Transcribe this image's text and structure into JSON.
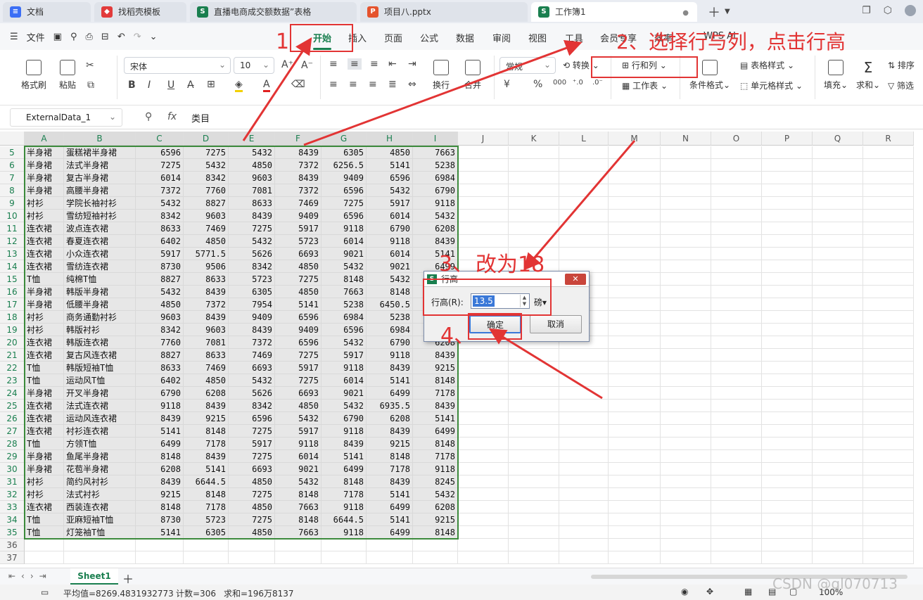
{
  "tabs": [
    {
      "label": "文档",
      "icon": "doc-icon",
      "color": "#3b6ef5"
    },
    {
      "label": "找稻壳模板",
      "icon": "docer-icon",
      "color": "#e23b3b"
    },
    {
      "label": "直播电商成交额数据”表格",
      "icon": "sheet-icon",
      "color": "#1a7f4f"
    },
    {
      "label": "项目八.pptx",
      "icon": "ppt-icon",
      "color": "#e5532d"
    },
    {
      "label": "工作簿1",
      "icon": "sheet-icon",
      "color": "#1a7f4f"
    }
  ],
  "menubar": {
    "file_label": "文件",
    "items": [
      "开始",
      "插入",
      "页面",
      "公式",
      "数据",
      "审阅",
      "视图",
      "工具",
      "会员专享",
      "效率",
      "WPS AI"
    ]
  },
  "ribbon": {
    "format_painter": "格式刷",
    "paste": "粘贴",
    "font_name": "宋体",
    "font_size": "10",
    "wrap": "换行",
    "merge": "合并",
    "number_format": "常规",
    "convert": "转换",
    "row_col": "行和列",
    "worksheet": "工作表",
    "table_style": "表格样式",
    "cond_format": "条件格式",
    "cell_style": "单元格样式",
    "fill": "填充",
    "sum": "求和",
    "sort": "排序",
    "filter": "筛选"
  },
  "formula_bar": {
    "name_box": "ExternalData_1",
    "content": "类目"
  },
  "columns": [
    "A",
    "B",
    "C",
    "D",
    "E",
    "F",
    "G",
    "H",
    "I",
    "J",
    "K",
    "L",
    "M",
    "N",
    "O",
    "P",
    "Q",
    "R"
  ],
  "rows": [
    {
      "n": "5",
      "a": "半身裙",
      "b": "蛋糕裙半身裙",
      "v": [
        "6596",
        "7275",
        "5432",
        "8439",
        "6305",
        "4850",
        "7663"
      ]
    },
    {
      "n": "6",
      "a": "半身裙",
      "b": "法式半身裙",
      "v": [
        "7275",
        "5432",
        "4850",
        "7372",
        "6256.5",
        "5141",
        "5238"
      ]
    },
    {
      "n": "7",
      "a": "半身裙",
      "b": "复古半身裙",
      "v": [
        "6014",
        "8342",
        "9603",
        "8439",
        "9409",
        "6596",
        "6984"
      ]
    },
    {
      "n": "8",
      "a": "半身裙",
      "b": "高腰半身裙",
      "v": [
        "7372",
        "7760",
        "7081",
        "7372",
        "6596",
        "5432",
        "6790"
      ]
    },
    {
      "n": "9",
      "a": "衬衫",
      "b": "学院长袖衬衫",
      "v": [
        "5432",
        "8827",
        "8633",
        "7469",
        "7275",
        "5917",
        "9118"
      ]
    },
    {
      "n": "10",
      "a": "衬衫",
      "b": "雪纺短袖衬衫",
      "v": [
        "8342",
        "9603",
        "8439",
        "9409",
        "6596",
        "6014",
        "5432"
      ]
    },
    {
      "n": "11",
      "a": "连衣裙",
      "b": "波点连衣裙",
      "v": [
        "8633",
        "7469",
        "7275",
        "5917",
        "9118",
        "6790",
        "6208"
      ]
    },
    {
      "n": "12",
      "a": "连衣裙",
      "b": "春夏连衣裙",
      "v": [
        "6402",
        "4850",
        "5432",
        "5723",
        "6014",
        "9118",
        "8439"
      ]
    },
    {
      "n": "13",
      "a": "连衣裙",
      "b": "小众连衣裙",
      "v": [
        "5917",
        "5771.5",
        "5626",
        "6693",
        "9021",
        "6014",
        "5141"
      ]
    },
    {
      "n": "14",
      "a": "连衣裙",
      "b": "雪纺连衣裙",
      "v": [
        "8730",
        "9506",
        "8342",
        "4850",
        "5432",
        "9021",
        "6499"
      ]
    },
    {
      "n": "15",
      "a": "T恤",
      "b": "纯棉T恤",
      "v": [
        "8827",
        "8633",
        "5723",
        "7275",
        "8148",
        "5432",
        "7178"
      ]
    },
    {
      "n": "16",
      "a": "半身裙",
      "b": "韩版半身裙",
      "v": [
        "5432",
        "8439",
        "6305",
        "4850",
        "7663",
        "8148",
        "6499"
      ]
    },
    {
      "n": "17",
      "a": "半身裙",
      "b": "低腰半身裙",
      "v": [
        "4850",
        "7372",
        "7954",
        "5141",
        "5238",
        "6450.5",
        "9118"
      ]
    },
    {
      "n": "18",
      "a": "衬衫",
      "b": "商务通勤衬衫",
      "v": [
        "9603",
        "8439",
        "9409",
        "6596",
        "6984",
        "5238",
        "8148"
      ]
    },
    {
      "n": "19",
      "a": "衬衫",
      "b": "韩版衬衫",
      "v": [
        "8342",
        "9603",
        "8439",
        "9409",
        "6596",
        "6984",
        "7178"
      ]
    },
    {
      "n": "20",
      "a": "连衣裙",
      "b": "韩版连衣裙",
      "v": [
        "7760",
        "7081",
        "7372",
        "6596",
        "5432",
        "6790",
        "6208"
      ]
    },
    {
      "n": "21",
      "a": "连衣裙",
      "b": "复古风连衣裙",
      "v": [
        "8827",
        "8633",
        "7469",
        "7275",
        "5917",
        "9118",
        "8439"
      ]
    },
    {
      "n": "22",
      "a": "T恤",
      "b": "韩版短袖T恤",
      "v": [
        "8633",
        "7469",
        "6693",
        "5917",
        "9118",
        "8439",
        "9215"
      ]
    },
    {
      "n": "23",
      "a": "T恤",
      "b": "运动风T恤",
      "v": [
        "6402",
        "4850",
        "5432",
        "7275",
        "6014",
        "5141",
        "8148"
      ]
    },
    {
      "n": "24",
      "a": "半身裙",
      "b": "开叉半身裙",
      "v": [
        "6790",
        "6208",
        "5626",
        "6693",
        "9021",
        "6499",
        "7178"
      ]
    },
    {
      "n": "25",
      "a": "连衣裙",
      "b": "法式连衣裙",
      "v": [
        "9118",
        "8439",
        "8342",
        "4850",
        "5432",
        "6935.5",
        "8439"
      ]
    },
    {
      "n": "26",
      "a": "连衣裙",
      "b": "运动风连衣裙",
      "v": [
        "8439",
        "9215",
        "6596",
        "5432",
        "6790",
        "6208",
        "5141"
      ]
    },
    {
      "n": "27",
      "a": "连衣裙",
      "b": "衬衫连衣裙",
      "v": [
        "5141",
        "8148",
        "7275",
        "5917",
        "9118",
        "8439",
        "6499"
      ]
    },
    {
      "n": "28",
      "a": "T恤",
      "b": "方领T恤",
      "v": [
        "6499",
        "7178",
        "5917",
        "9118",
        "8439",
        "9215",
        "8148"
      ]
    },
    {
      "n": "29",
      "a": "半身裙",
      "b": "鱼尾半身裙",
      "v": [
        "8148",
        "8439",
        "7275",
        "6014",
        "5141",
        "8148",
        "7178"
      ]
    },
    {
      "n": "30",
      "a": "半身裙",
      "b": "花苞半身裙",
      "v": [
        "6208",
        "5141",
        "6693",
        "9021",
        "6499",
        "7178",
        "9118"
      ]
    },
    {
      "n": "31",
      "a": "衬衫",
      "b": "简约风衬衫",
      "v": [
        "8439",
        "6644.5",
        "4850",
        "5432",
        "8148",
        "8439",
        "8245"
      ]
    },
    {
      "n": "32",
      "a": "衬衫",
      "b": "法式衬衫",
      "v": [
        "9215",
        "8148",
        "7275",
        "8148",
        "7178",
        "5141",
        "5432"
      ]
    },
    {
      "n": "33",
      "a": "连衣裙",
      "b": "西装连衣裙",
      "v": [
        "8148",
        "7178",
        "4850",
        "7663",
        "9118",
        "6499",
        "6208"
      ]
    },
    {
      "n": "34",
      "a": "T恤",
      "b": "亚麻短袖T恤",
      "v": [
        "8730",
        "5723",
        "7275",
        "8148",
        "6644.5",
        "5141",
        "9215"
      ]
    },
    {
      "n": "35",
      "a": "T恤",
      "b": "灯笼袖T恤",
      "v": [
        "5141",
        "6305",
        "4850",
        "7663",
        "9118",
        "6499",
        "8148"
      ]
    }
  ],
  "empty_rows": [
    "36",
    "37"
  ],
  "sheet_tab": "Sheet1",
  "status": {
    "avg": "平均值=8269.4831932773",
    "count": "计数=306",
    "sum": "求和=196万8137",
    "zoom": "100%"
  },
  "dialog": {
    "title": "行高",
    "label": "行高(R):",
    "value": "13.5",
    "unit": "磅",
    "ok": "确定",
    "cancel": "取消"
  },
  "annotations": {
    "step1": "1",
    "step2": "2、选择行与列，点击行高",
    "step3_num": "3、",
    "step3_text": "改为18",
    "step4": "4、"
  },
  "watermark": "CSDN @gl070713",
  "accent_color": "#1a7f4f",
  "annotation_color": "#e23434"
}
